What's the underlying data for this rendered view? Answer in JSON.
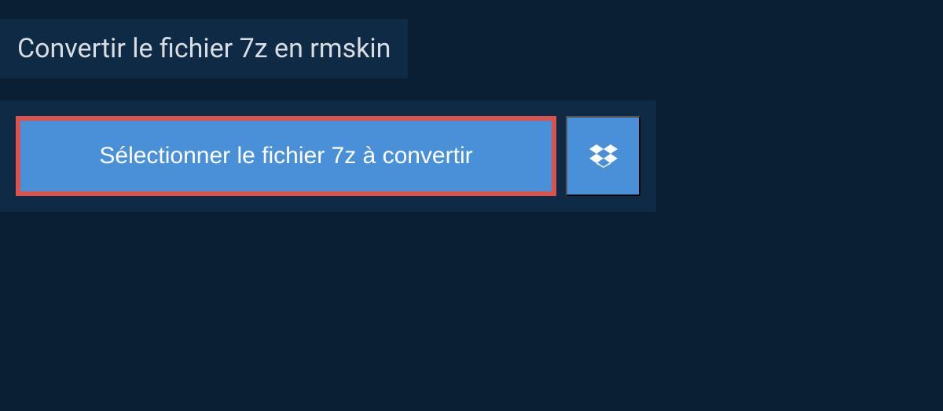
{
  "header": {
    "title": "Convertir le fichier 7z en rmskin"
  },
  "upload": {
    "select_button_label": "Sélectionner le fichier 7z à convertir"
  },
  "colors": {
    "page_bg": "#0a1f33",
    "panel_bg": "#0f2a45",
    "button_bg": "#4a90d9",
    "highlight_border": "#d9534f",
    "title_text": "#d8dde3",
    "button_text": "#ffffff"
  }
}
